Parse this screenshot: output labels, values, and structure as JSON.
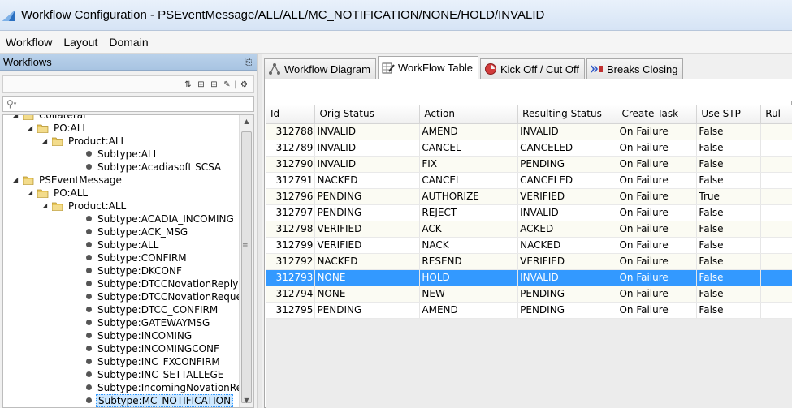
{
  "window": {
    "title": "Workflow Configuration - PSEventMessage/ALL/ALL/MC_NOTIFICATION/NONE/HOLD/INVALID"
  },
  "menu": [
    "Workflow",
    "Layout",
    "Domain"
  ],
  "left_panel": {
    "title": "Workflows",
    "search_placeholder": "",
    "tree": [
      {
        "label": "Collateral",
        "level": 1,
        "type": "folder",
        "expanded": true
      },
      {
        "label": "PO:ALL",
        "level": 2,
        "type": "folder",
        "expanded": true
      },
      {
        "label": "Product:ALL",
        "level": 3,
        "type": "folder",
        "expanded": true
      },
      {
        "label": "Subtype:ALL",
        "level": 4,
        "type": "leaf"
      },
      {
        "label": "Subtype:Acadiasoft SCSA",
        "level": 4,
        "type": "leaf"
      },
      {
        "label": "PSEventMessage",
        "level": 1,
        "type": "folder",
        "expanded": true
      },
      {
        "label": "PO:ALL",
        "level": 2,
        "type": "folder",
        "expanded": true
      },
      {
        "label": "Product:ALL",
        "level": 3,
        "type": "folder",
        "expanded": true
      },
      {
        "label": "Subtype:ACADIA_INCOMING",
        "level": 4,
        "type": "leaf"
      },
      {
        "label": "Subtype:ACK_MSG",
        "level": 4,
        "type": "leaf"
      },
      {
        "label": "Subtype:ALL",
        "level": 4,
        "type": "leaf"
      },
      {
        "label": "Subtype:CONFIRM",
        "level": 4,
        "type": "leaf"
      },
      {
        "label": "Subtype:DKCONF",
        "level": 4,
        "type": "leaf"
      },
      {
        "label": "Subtype:DTCCNovationReply",
        "level": 4,
        "type": "leaf"
      },
      {
        "label": "Subtype:DTCCNovationRequest",
        "level": 4,
        "type": "leaf"
      },
      {
        "label": "Subtype:DTCC_CONFIRM",
        "level": 4,
        "type": "leaf"
      },
      {
        "label": "Subtype:GATEWAYMSG",
        "level": 4,
        "type": "leaf"
      },
      {
        "label": "Subtype:INCOMING",
        "level": 4,
        "type": "leaf"
      },
      {
        "label": "Subtype:INCOMINGCONF",
        "level": 4,
        "type": "leaf"
      },
      {
        "label": "Subtype:INC_FXCONFIRM",
        "level": 4,
        "type": "leaf"
      },
      {
        "label": "Subtype:INC_SETTALLEGE",
        "level": 4,
        "type": "leaf"
      },
      {
        "label": "Subtype:IncomingNovationRequest",
        "level": 4,
        "type": "leaf"
      },
      {
        "label": "Subtype:MC_NOTIFICATION",
        "level": 4,
        "type": "leaf",
        "selected": true
      }
    ]
  },
  "tabs": [
    {
      "label": "Workflow Diagram",
      "icon": "diagram-icon",
      "active": false
    },
    {
      "label": "WorkFlow Table",
      "icon": "table-edit-icon",
      "active": true
    },
    {
      "label": "Kick Off / Cut Off",
      "icon": "clock-icon",
      "active": false
    },
    {
      "label": "Breaks Closing",
      "icon": "breaks-icon",
      "active": false
    }
  ],
  "table": {
    "columns": [
      "Id",
      "Orig Status",
      "Action",
      "Resulting Status",
      "Create Task",
      "Use STP",
      "Rul"
    ],
    "rows": [
      [
        "312788",
        "INVALID",
        "AMEND",
        "INVALID",
        "On Failure",
        "False",
        ""
      ],
      [
        "312789",
        "INVALID",
        "CANCEL",
        "CANCELED",
        "On Failure",
        "False",
        ""
      ],
      [
        "312790",
        "INVALID",
        "FIX",
        "PENDING",
        "On Failure",
        "False",
        ""
      ],
      [
        "312791",
        "NACKED",
        "CANCEL",
        "CANCELED",
        "On Failure",
        "False",
        ""
      ],
      [
        "312796",
        "PENDING",
        "AUTHORIZE",
        "VERIFIED",
        "On Failure",
        "True",
        ""
      ],
      [
        "312797",
        "PENDING",
        "REJECT",
        "INVALID",
        "On Failure",
        "False",
        ""
      ],
      [
        "312798",
        "VERIFIED",
        "ACK",
        "ACKED",
        "On Failure",
        "False",
        ""
      ],
      [
        "312799",
        "VERIFIED",
        "NACK",
        "NACKED",
        "On Failure",
        "False",
        ""
      ],
      [
        "312792",
        "NACKED",
        "RESEND",
        "VERIFIED",
        "On Failure",
        "False",
        ""
      ],
      [
        "312793",
        "NONE",
        "HOLD",
        "INVALID",
        "On Failure",
        "False",
        ""
      ],
      [
        "312794",
        "NONE",
        "NEW",
        "PENDING",
        "On Failure",
        "False",
        ""
      ],
      [
        "312795",
        "PENDING",
        "AMEND",
        "PENDING",
        "On Failure",
        "False",
        ""
      ]
    ],
    "selected_row": 9
  },
  "colors": {
    "selection": "#3399ff",
    "header_gradient_top": "#e9f1fb",
    "panel_header": "#b9d1ea",
    "folder": "#e8c65a"
  }
}
